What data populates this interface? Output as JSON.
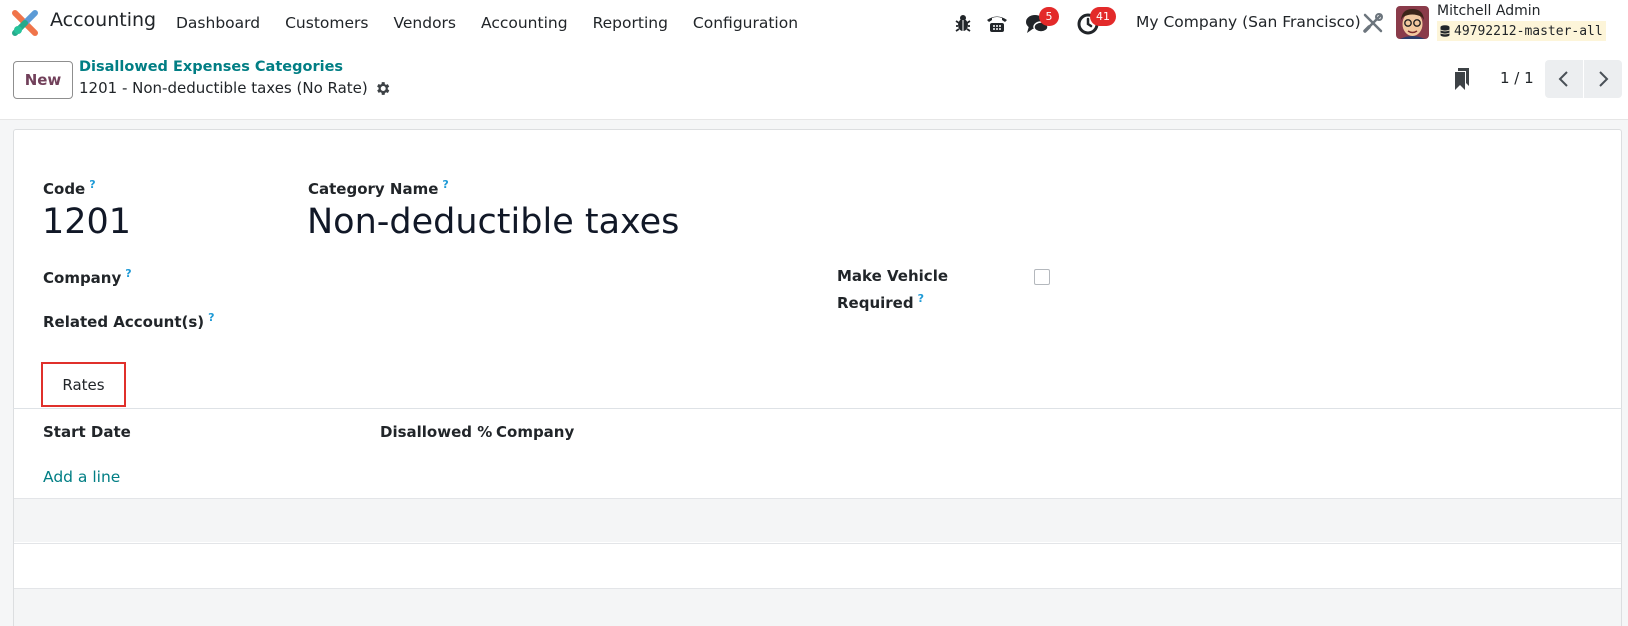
{
  "navbar": {
    "app_name": "Accounting",
    "menu": [
      "Dashboard",
      "Customers",
      "Vendors",
      "Accounting",
      "Reporting",
      "Configuration"
    ],
    "chat_badge": "5",
    "activity_badge": "41",
    "company": "My Company (San Francisco)",
    "user_name": "Mitchell Admin",
    "database": "49792212-master-all",
    "icons": [
      "bug-icon",
      "phone-icon",
      "chat-icon",
      "clock-icon",
      "tools-icon"
    ]
  },
  "control": {
    "new_label": "New",
    "breadcrumb_parent": "Disallowed Expenses Categories",
    "breadcrumb_current": "1201 - Non-deductible taxes (No Rate)",
    "pager": "1 / 1"
  },
  "form": {
    "code_label": "Code",
    "code_value": "1201",
    "name_label": "Category Name",
    "name_value": "Non-deductible taxes",
    "company_label": "Company",
    "accounts_label": "Related Account(s)",
    "vehicle_label_1": "Make Vehicle",
    "vehicle_label_2": "Required",
    "help_mark": "?"
  },
  "tabs": {
    "rates": "Rates"
  },
  "rates_table": {
    "columns": [
      "Start Date",
      "Disallowed %",
      "Company"
    ],
    "add_line": "Add a line"
  },
  "colors": {
    "accent": "#017e84",
    "brand": "#71405a",
    "badge": "#e32a2a",
    "highlight": "#e0302b",
    "help": "#1f9ad6"
  }
}
